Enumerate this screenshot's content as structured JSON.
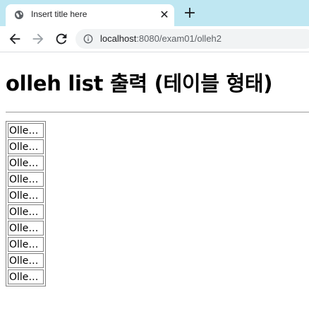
{
  "browser": {
    "tab": {
      "title": "Insert title here",
      "favicon": "globe-icon",
      "close_icon": "close-icon"
    },
    "new_tab_icon": "plus-icon",
    "toolbar": {
      "back_icon": "back-arrow-icon",
      "forward_icon": "forward-arrow-icon",
      "reload_icon": "reload-icon",
      "info_icon": "info-icon"
    },
    "address": {
      "host": "localhost",
      "path": ":8080/exam01/olleh2"
    }
  },
  "page": {
    "heading": "olleh list 출력 (테이블 형태)",
    "rows": [
      "Olleh...",
      "Olleh...",
      "Olleh...",
      "Olleh...",
      "Olleh...",
      "Olleh...",
      "Olleh...",
      "Olleh...",
      "Olleh...",
      "Olleh..."
    ]
  }
}
